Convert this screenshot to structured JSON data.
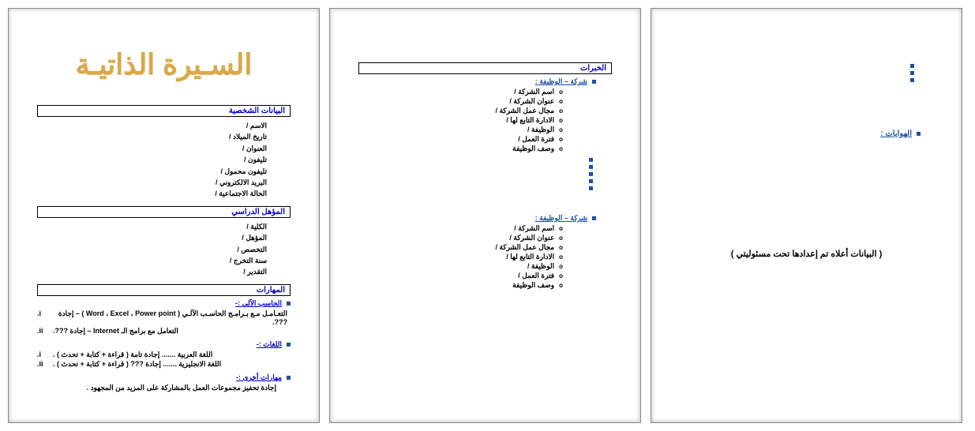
{
  "title": "السـيرة الذاتيـة",
  "sections": {
    "personal": {
      "header": "البيانات الشخصية",
      "fields": [
        "الاسم",
        "تاريخ الميلاد",
        "العنوان",
        "تليفون",
        "تليفون محمول",
        "البريد الالكتروني",
        "الحالة الاجتماعية"
      ]
    },
    "education": {
      "header": "المؤهل الدراسي",
      "fields": [
        "الكلية",
        "المؤهل",
        "التخصص",
        "سنة التخرج",
        "التقدير"
      ]
    },
    "skills": {
      "header": "المهارات",
      "computer": {
        "label": "الحاسب الآلي :-",
        "items": [
          "التعـامـل مـع بـرامـج الحاسـب الآلـي ( Word ، Excel ، Power point ) – إجادة ???.",
          "التعامل مع برامج الـ Internet – إجادة ???."
        ]
      },
      "languages": {
        "label": "اللغات :-",
        "items": [
          "اللغة العربية ....... إجادة تامة ( قراءة + كتابة + تحدث ) .",
          "اللغة الانجليزية ....... إجادة ??? ( قراءة + كتابة + تحدث ) ."
        ]
      },
      "other": {
        "label": "مهارات أخرى :-",
        "text": "إجادة تحفيز مجموعات العمل بالمشاركة على المزيد من المجهود ."
      }
    },
    "experience": {
      "header": "الخبرات",
      "job_label": "شركة – الوظيفة :",
      "fields": [
        "اسم الشركة",
        "عنوان الشركة",
        "مجال عمل الشركة",
        "الادارة التابع لها",
        "الوظيفة",
        "فترة العمل",
        "وصف الوظيفة"
      ]
    },
    "hobbies": {
      "label": "الهوايات :"
    },
    "disclaimer": "البيانات أعلاه تم إعدادها تحت مسئوليتي"
  }
}
